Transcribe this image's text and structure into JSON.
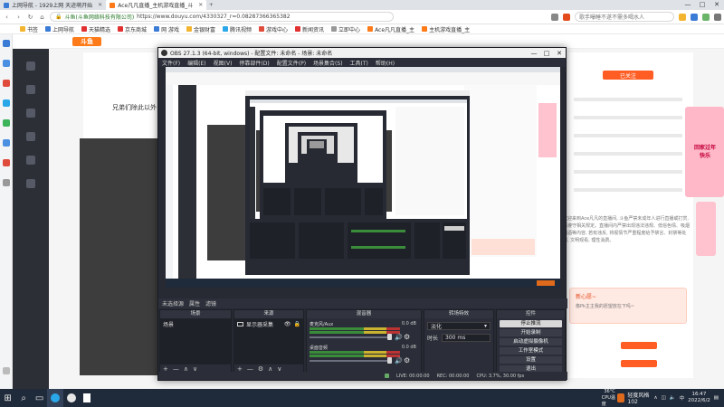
{
  "browser": {
    "tabs": [
      {
        "label": "上网导航 - 1929上网 天迹萌开始",
        "active": false,
        "icon_color": "#3a7bd5"
      },
      {
        "label": "Ace凡凡直播_主机游戏直播_斗",
        "active": true,
        "icon_color": "#ff7a18"
      }
    ],
    "new_tab_icon": "+",
    "window_controls": {
      "minimize": "—",
      "maximize": "□",
      "close": "✕"
    },
    "url": {
      "site_label": "斗鱼(斗鱼网络科技有限公司)",
      "address": "https://www.douyu.com/4330327_r=0.08287366365382"
    },
    "search_placeholder": "歌手曝睡不遂不需多喝水人",
    "bookmarks": [
      {
        "label": "书签",
        "color": "#f3b42f"
      },
      {
        "label": "上网导航",
        "color": "#3a7bd5"
      },
      {
        "label": "天猫精选",
        "color": "#e0302f"
      },
      {
        "label": "京东商城",
        "color": "#e0302f"
      },
      {
        "label": "网 游戏",
        "color": "#3a7bd5"
      },
      {
        "label": "金银财富",
        "color": "#f3b42f"
      },
      {
        "label": "腾讯视频",
        "color": "#2aa7e8"
      },
      {
        "label": "游戏中心",
        "color": "#e04c3c"
      },
      {
        "label": "新闻资讯",
        "color": "#e0302f"
      },
      {
        "label": "立即中心",
        "color": "#999999"
      },
      {
        "label": "Ace凡凡直播_主",
        "color": "#ff7a18"
      },
      {
        "label": "主机游戏直播_主",
        "color": "#ff7a18"
      }
    ]
  },
  "webpage": {
    "logo_text": "斗鱼",
    "anchor_title": "兄弟们除此以外",
    "follow_label": "已关注",
    "chat_text": "欢迎来到Ace凡凡的直播间, 斗鱼严禁未成年人进行直播或打赏, 请遵守相关规定。直播间内严禁出现违法违规、低俗色情、吸烟酗酒等内容, 若有违反, 将视情节严重程度给予禁言、封禁等处罚, 文明观看, 理性消费。",
    "promo_title": "新心愿~",
    "promo_sub": "像Pk主主我的愿望放在下吗~",
    "gift_text": "回家过年 快乐"
  },
  "obs": {
    "title": "OBS 27.1.3 (64-bit, windows) - 配置文件: 未命名 - 场景: 未命名",
    "menu": [
      "文件(F)",
      "编辑(E)",
      "视图(V)",
      "停靠部件(D)",
      "配置文件(P)",
      "场景集合(S)",
      "工具(T)",
      "帮助(H)"
    ],
    "scene_strip": [
      "未选择源",
      "属性",
      "滤镜"
    ],
    "docks": {
      "scenes": {
        "title": "场景",
        "items": [
          "场景"
        ]
      },
      "sources": {
        "title": "来源",
        "items": [
          "显示器采集"
        ]
      },
      "mixer": {
        "title": "混音器",
        "channels": [
          {
            "name": "麦克风/Aux",
            "db": "0.0 dB"
          },
          {
            "name": "桌面音频",
            "db": "0.0 dB"
          }
        ]
      },
      "transitions": {
        "title": "转场特效",
        "type": "淡化",
        "duration_label": "时长",
        "duration": "300 ms"
      },
      "controls": {
        "title": "控件",
        "buttons": [
          "停止推流",
          "开始录制",
          "启动虚拟摄像机",
          "工作室模式",
          "设置",
          "退出"
        ]
      }
    },
    "footer_icons": [
      "+",
      "—",
      "⚙",
      "∧",
      "∨"
    ],
    "status": {
      "live": "LIVE: 00:00:00",
      "rec": "REC: 00:00:00",
      "cpu": "CPU: 3.7%, 30.00 fps"
    }
  },
  "taskbar": {
    "start_icon": "⊞",
    "weather_temp": "36°C",
    "weather_label": "CPU温度",
    "tray_app_label": "轻度风格 102",
    "time": "16:47",
    "date": "2022/6/2"
  },
  "colors": {
    "douyu_orange": "#ff7a18",
    "obs_dark": "#272a33",
    "taskbar": "#1f2a3a"
  }
}
